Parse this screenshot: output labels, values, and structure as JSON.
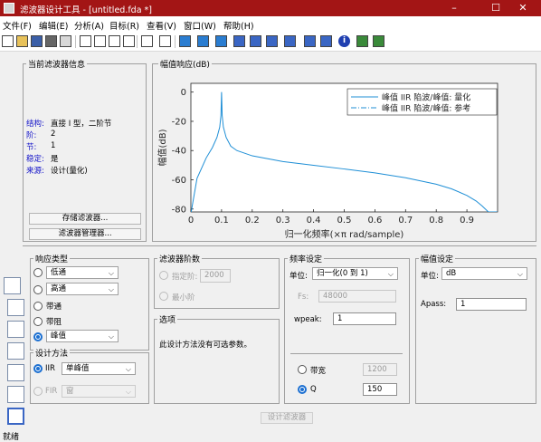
{
  "window": {
    "title": "滤波器设计工具 - [untitled.fda *]",
    "minimize": "–",
    "maximize": "☐",
    "close": "✕"
  },
  "menu": [
    "文件(F)",
    "编辑(E)",
    "分析(A)",
    "目标(R)",
    "查看(V)",
    "窗口(W)",
    "帮助(H)"
  ],
  "toolbar_icons": [
    "new-icon",
    "open-icon",
    "save-icon",
    "print-icon",
    "print-preview-icon",
    "zoom-in-icon",
    "zoom-x-icon",
    "zoom-y-icon",
    "full-view-icon",
    "filter-spec-icon",
    "legend-icon",
    "magnitude-response-icon",
    "phase-response-icon",
    "mag-phase-icon",
    "group-delay-icon",
    "phase-delay-icon",
    "impulse-response-icon",
    "step-response-icon",
    "pole-zero-icon",
    "coefficients-icon",
    "info-icon",
    "cost-icon",
    "notch-icon"
  ],
  "info_panel": {
    "title": "当前滤波器信息",
    "rows": [
      {
        "key": "结构:",
        "value": "直接 I 型，二阶节"
      },
      {
        "key": "阶:",
        "value": "2"
      },
      {
        "key": "节:",
        "value": "1"
      },
      {
        "key": "稳定:",
        "value": "是"
      },
      {
        "key": "来源:",
        "value": "设计(量化)"
      }
    ],
    "store_button": "存储滤波器...",
    "manager_button": "滤波器管理器..."
  },
  "plot_panel": {
    "title": "幅值响应(dB)"
  },
  "chart_data": {
    "type": "line",
    "xlabel": "归一化频率(×π rad/sample)",
    "ylabel": "幅值(dB)",
    "xlim": [
      0,
      1
    ],
    "ylim": [
      -82,
      6
    ],
    "xticks": [
      "0",
      "0.1",
      "0.2",
      "0.3",
      "0.4",
      "0.5",
      "0.6",
      "0.7",
      "0.8",
      "0.9"
    ],
    "yticks": [
      "0",
      "-20",
      "-40",
      "-60",
      "-80"
    ],
    "legend_position": "top-right",
    "series": [
      {
        "name": "峰值 IIR 陷波/峰值: 量化",
        "color": "#1f8fd6",
        "style": "solid",
        "x": [
          0.001,
          0.02,
          0.05,
          0.07,
          0.085,
          0.094,
          0.098,
          0.1,
          0.102,
          0.106,
          0.115,
          0.13,
          0.15,
          0.2,
          0.3,
          0.4,
          0.5,
          0.6,
          0.7,
          0.8,
          0.85,
          0.9,
          0.93,
          0.95,
          0.97,
          0.98,
          0.99,
          0.995,
          0.999
        ],
        "y": [
          -82,
          -59,
          -45,
          -38,
          -31,
          -24,
          -16,
          0,
          -16,
          -24,
          -31,
          -37,
          -40,
          -43.6,
          -47.5,
          -50.1,
          -52.6,
          -55.3,
          -58.6,
          -63.0,
          -66.2,
          -70.7,
          -74.5,
          -78.0,
          -82,
          -82,
          -82,
          -82,
          -82
        ]
      },
      {
        "name": "峰值 IIR 陷波/峰值: 参考",
        "color": "#1f8fd6",
        "style": "dashdot",
        "x": [],
        "y": []
      }
    ]
  },
  "response_type": {
    "title": "响应类型",
    "options": [
      {
        "label": "低通",
        "select": "低通",
        "selected": false
      },
      {
        "label": "高通",
        "select": "高通",
        "selected": false
      },
      {
        "label": "带通",
        "selected": false
      },
      {
        "label": "带阻",
        "selected": false
      },
      {
        "label": "",
        "select": "峰值",
        "selected": true
      }
    ]
  },
  "design_method": {
    "title": "设计方法",
    "iir_label": "IIR",
    "iir_value": "单峰值",
    "fir_label": "FIR",
    "fir_value": "窗"
  },
  "filter_order": {
    "title": "滤波器阶数",
    "specify_label": "指定阶:",
    "specify_value": "2000",
    "minimum_label": "最小阶"
  },
  "options": {
    "title": "选项",
    "text": "此设计方法没有可选参数。"
  },
  "freq_spec": {
    "title": "频率设定",
    "unit_label": "单位:",
    "unit_value": "归一化(0 到 1)",
    "fs_label": "Fs:",
    "fs_value": "48000",
    "wpeak_label": "wpeak:",
    "wpeak_value": "1",
    "bandwidth_label": "带宽",
    "bandwidth_value": "1200",
    "q_label": "Q",
    "q_value": "150"
  },
  "mag_spec": {
    "title": "幅值设定",
    "unit_label": "单位:",
    "unit_value": "dB",
    "apass_label": "Apass:",
    "apass_value": "1"
  },
  "design_button": "设计滤波器",
  "side_icons": [
    "sos-icon",
    "transform-icon",
    "quantize-icon",
    "realize-model-icon",
    "import-icon",
    "multirate-icon",
    "pole-zero-editor-icon",
    "design-filter-icon"
  ],
  "status": "就绪"
}
